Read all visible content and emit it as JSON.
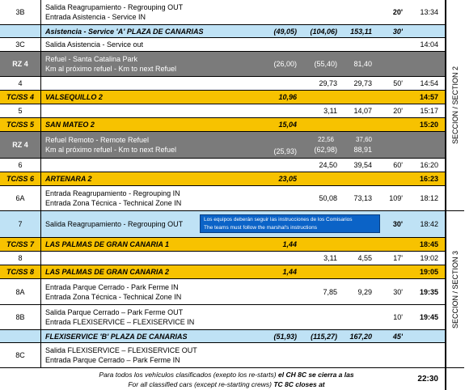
{
  "colors": {
    "gold": "#f7c200",
    "grey": "#7b7b7b",
    "blue": "#bfe2f5",
    "notice": "#0b63c7"
  },
  "rows": [
    {
      "id": "3B",
      "desc1": "Salida Reagrupamiento - Regrouping OUT",
      "desc2": "Entrada Asistencia - Service IN",
      "v1": "",
      "v2": "",
      "v3": "",
      "v4": "20'",
      "time": "13:34"
    },
    {
      "id": "",
      "desc1": "Asistencia - Service 'A' PLAZA DE CANARIAS",
      "desc2": "",
      "v1": "(49,05)",
      "v2": "(104,06)",
      "v3": "153,11",
      "v4": "30'",
      "time": ""
    },
    {
      "id": "3C",
      "desc1": "Salida Asistencia - Service out",
      "desc2": "",
      "v1": "",
      "v2": "",
      "v3": "",
      "v4": "",
      "time": "14:04"
    },
    {
      "id": "RZ 4",
      "desc1": "Refuel - Santa Catalina Park",
      "desc2": "Km al próximo refuel - Km to next Refuel",
      "v1": "(26,00)",
      "v2": "(55,40)",
      "v3": "81,40",
      "v4": "",
      "time": ""
    },
    {
      "id": "4",
      "desc1": "",
      "desc2": "",
      "v1": "",
      "v2": "29,73",
      "v3": "29,73",
      "v4": "50'",
      "time": "14:54"
    },
    {
      "id": "TC/SS 4",
      "desc1": "VALSEQUILLO 2",
      "desc2": "",
      "v1": "10,96",
      "v2": "",
      "v3": "",
      "v4": "",
      "time": "14:57"
    },
    {
      "id": "5",
      "desc1": "",
      "desc2": "",
      "v1": "",
      "v2": "3,11",
      "v3": "14,07",
      "v4": "20'",
      "time": "15:17"
    },
    {
      "id": "TC/SS 5",
      "desc1": "SAN MATEO 2",
      "desc2": "",
      "v1": "15,04",
      "v2": "",
      "v3": "",
      "v4": "",
      "time": "15:20"
    },
    {
      "id": "RZ 4",
      "desc1": "Refuel Remoto - Remote Refuel",
      "desc2": "Km al próximo refuel - Km to next Refuel",
      "v1": "(25,93)",
      "v2a": "22,56",
      "v2": "(62,98)",
      "v3a": "37,60",
      "v3": "88,91",
      "v4": "",
      "time": ""
    },
    {
      "id": "6",
      "desc1": "",
      "desc2": "",
      "v1": "",
      "v2": "24,50",
      "v3": "39,54",
      "v4": "60'",
      "time": "16:20"
    },
    {
      "id": "TC/SS 6",
      "desc1": "ARTENARA 2",
      "desc2": "",
      "v1": "23,05",
      "v2": "",
      "v3": "",
      "v4": "",
      "time": "16:23"
    },
    {
      "id": "6A",
      "desc1": "Entrada Reagrupamiento - Regrouping IN",
      "desc2": "Entrada Zona Técnica - Technical Zone IN",
      "v1": "",
      "v2": "50,08",
      "v3": "73,13",
      "v4": "109'",
      "time": "18:12"
    },
    {
      "id": "7",
      "desc1": "Salida Reagrupamiento - Regrouping OUT",
      "desc2": "",
      "v1": "",
      "v2": "",
      "v3": "",
      "v4": "30'",
      "time": "18:42"
    },
    {
      "id": "TC/SS 7",
      "desc1": "LAS PALMAS DE GRAN CANARIA 1",
      "desc2": "",
      "v1": "1,44",
      "v2": "",
      "v3": "",
      "v4": "",
      "time": "18:45"
    },
    {
      "id": "8",
      "desc1": "",
      "desc2": "",
      "v1": "",
      "v2": "3,11",
      "v3": "4,55",
      "v4": "17'",
      "time": "19:02"
    },
    {
      "id": "TC/SS 8",
      "desc1": "LAS PALMAS DE GRAN CANARIA 2",
      "desc2": "",
      "v1": "1,44",
      "v2": "",
      "v3": "",
      "v4": "",
      "time": "19:05"
    },
    {
      "id": "8A",
      "desc1": "Entrada Parque Cerrado - Park Ferme IN",
      "desc2": "Entrada Zona Técnica - Technical Zone IN",
      "v1": "",
      "v2": "7,85",
      "v3": "9,29",
      "v4": "30'",
      "time": "19:35"
    },
    {
      "id": "8B",
      "desc1": "Salida Parque Cerrado – Park Ferme OUT",
      "desc2": "Entrada FLEXISERVICE – FLEXISERVICE IN",
      "v1": "",
      "v2": "",
      "v3": "",
      "v4": "10'",
      "time": "19:45"
    },
    {
      "id": "",
      "desc1": "FLEXISERVICE 'B' PLAZA DE CANARIAS",
      "desc2": "",
      "v1": "(51,93)",
      "v2": "(115,27)",
      "v3": "167,20",
      "v4": "45'",
      "time": ""
    },
    {
      "id": "8C",
      "desc1": "Salida FLEXISERVICE – FLEXISERVICE OUT",
      "desc2": "Entrada Parque Cerrado – Park Ferme IN",
      "v1": "",
      "v2": "",
      "v3": "",
      "v4": "",
      "time": ""
    }
  ],
  "notice": {
    "line1": "Los equipos deberán seguir las instrucciones de los Comisarios",
    "line2": "The teams must follow the marshal's instructions"
  },
  "footer": {
    "line1_a": "Para todos los vehículos clasificados (exepto los re-starts) ",
    "line1_b": "el CH 8C se cierra a las",
    "line2_a": "For all classified cars  (except re-starting crews) ",
    "line2_b": "TC 8C closes at",
    "time": "22:30"
  },
  "side": {
    "section2": "SECCION / SECTION 2",
    "section3": "SECCION / SECTION 3"
  }
}
